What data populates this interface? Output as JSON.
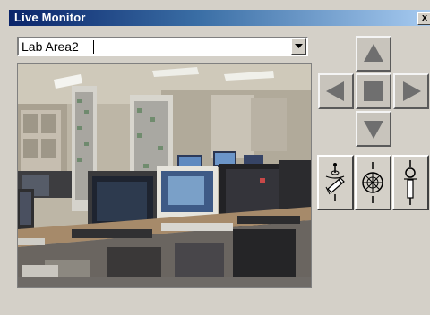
{
  "window": {
    "title": "Live Monitor",
    "close_label": "x"
  },
  "camera_select": {
    "value": "Lab Area2",
    "dropdown_icon": "chevron-down-icon"
  },
  "video": {
    "content": "live camera feed of a computer lab"
  },
  "ptz": {
    "up_icon": "arrow-up-icon",
    "left_icon": "arrow-left-icon",
    "home_icon": "square-stop-icon",
    "right_icon": "arrow-right-icon",
    "down_icon": "arrow-down-icon"
  },
  "tools": {
    "zoom_icon": "zoom-icon",
    "focus_icon": "focus-icon",
    "iris_icon": "iris-icon"
  }
}
